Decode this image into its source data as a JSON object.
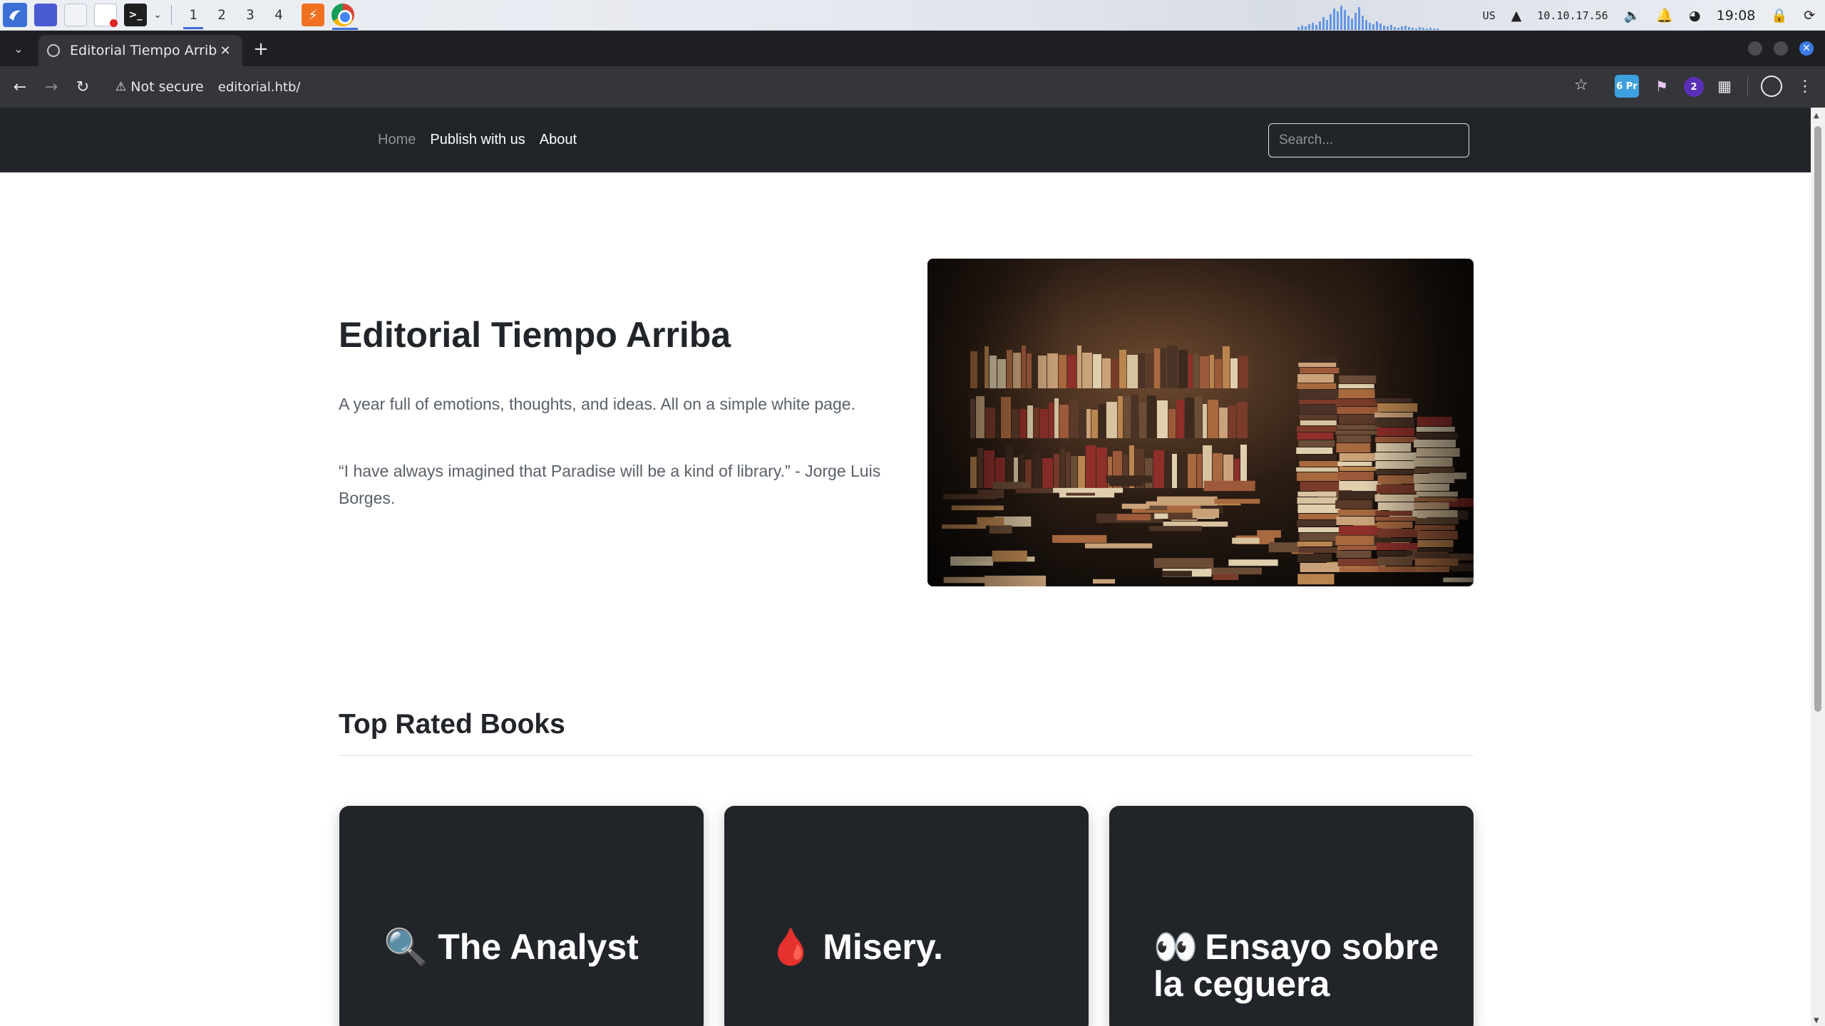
{
  "taskbar": {
    "workspaces": [
      "1",
      "2",
      "3",
      "4"
    ],
    "active_workspace": "1",
    "keyboard_layout": "US",
    "ip_address": "10.10.17.56",
    "clock": "19:08"
  },
  "browser": {
    "tab_title": "Editorial Tiempo Arriba",
    "security_label": "Not secure",
    "url": "editorial.htb/",
    "extension_badge_1": "6 Pr",
    "extension_badge_3": "2"
  },
  "site": {
    "nav": {
      "home": "Home",
      "publish": "Publish with us",
      "about": "About"
    },
    "search_placeholder": "Search...",
    "hero": {
      "title": "Editorial Tiempo Arriba",
      "lead": "A year full of emotions, thoughts, and ideas. All on a simple white page.",
      "quote": "“I have always imagined that Paradise will be a kind of library.” - Jorge Luis Borges."
    },
    "top_rated_title": "Top Rated Books",
    "books": [
      {
        "icon": "🔍",
        "title": "The Analyst"
      },
      {
        "icon": "🩸",
        "title": "Misery."
      },
      {
        "icon": "👀",
        "title": "Ensayo sobre la ceguera"
      }
    ]
  },
  "icons": {
    "tab_list": "chevron-down-icon",
    "back": "arrow-left-icon",
    "forward": "arrow-right-icon",
    "reload": "reload-icon",
    "warning": "warning-triangle-icon",
    "bookmark": "star-icon",
    "extensions": "puzzle-icon",
    "profile": "profile-icon",
    "menu": "kebab-menu-icon"
  },
  "colors": {
    "navbar_bg": "#212529",
    "card_bg": "#212529",
    "browser_tab": "#35363a",
    "accent_blue": "#3b6fd6"
  }
}
